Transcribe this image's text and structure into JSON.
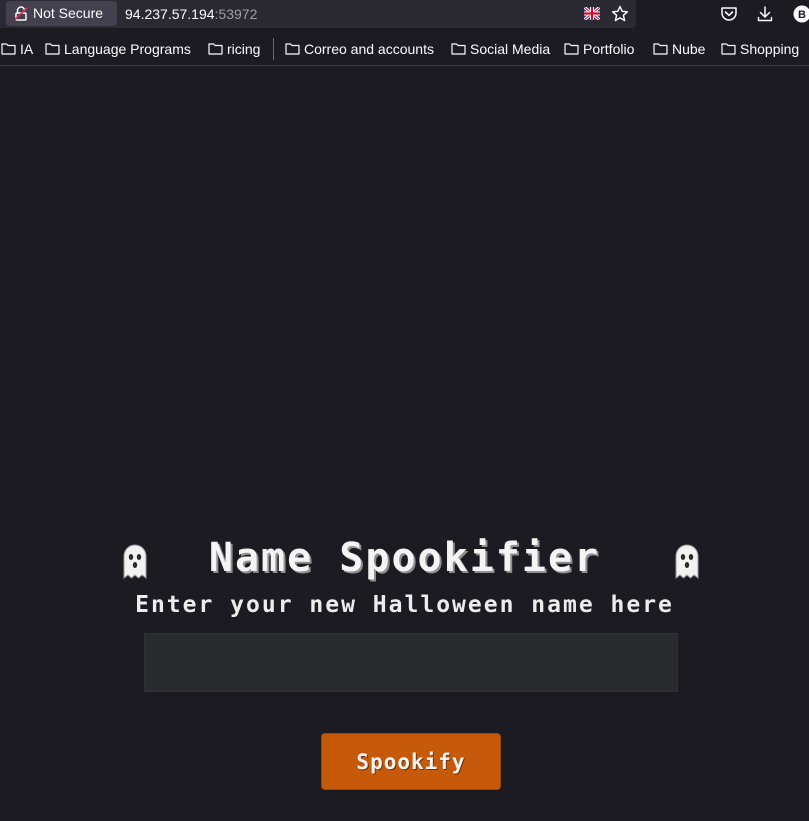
{
  "browser": {
    "security_label": "Not Secure",
    "url_host": "94.237.57.194",
    "url_port": ":53972",
    "toolbar_icons": [
      "flag-uk-icon",
      "star-icon",
      "pocket-icon",
      "download-icon",
      "extension-icon"
    ],
    "extension_letter": "B"
  },
  "bookmarks": [
    {
      "label": "IA",
      "icon": "folder-icon"
    },
    {
      "label": "Language Programs",
      "icon": "folder-icon"
    },
    {
      "label": "ricing",
      "icon": "folder-icon"
    },
    {
      "label": "Correo and accounts",
      "icon": "folder-icon"
    },
    {
      "label": "Social Media",
      "icon": "folder-icon"
    },
    {
      "label": "Portfolio",
      "icon": "folder-icon"
    },
    {
      "label": "Nube",
      "icon": "folder-icon"
    },
    {
      "label": "Shopping",
      "icon": "folder-icon"
    }
  ],
  "page": {
    "title": "Name Spookifier",
    "subtitle": "Enter your new Halloween name here",
    "input_value": "",
    "input_placeholder": "",
    "button_label": "Spookify",
    "decor_icons": [
      "ghost-icon",
      "ghost-icon"
    ]
  },
  "colors": {
    "background": "#1c1b22",
    "button": "#c65a0a",
    "input": "#292b2f",
    "text": "#f4f4f4"
  }
}
